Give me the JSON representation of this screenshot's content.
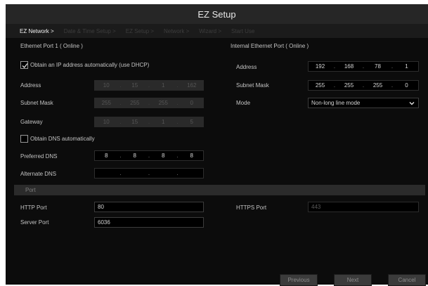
{
  "window": {
    "title": "EZ Setup"
  },
  "steps": [
    {
      "label": "EZ Network >",
      "active": true
    },
    {
      "label": "Date & Time Setup >",
      "active": false
    },
    {
      "label": "EZ Setup >",
      "active": false
    },
    {
      "label": "Network >",
      "active": false
    },
    {
      "label": "Wizard >",
      "active": false
    },
    {
      "label": "Start Use",
      "active": false
    }
  ],
  "ethernet": {
    "section_label": "Ethernet Port 1 ( Online )",
    "dhcp_checkbox": {
      "label": "Obtain an IP address automatically (use DHCP)",
      "checked": true
    },
    "address": {
      "label": "Address",
      "octets": [
        "10",
        "15",
        "1",
        "162"
      ]
    },
    "subnet_mask": {
      "label": "Subnet Mask",
      "octets": [
        "255",
        "255",
        "255",
        "0"
      ]
    },
    "gateway": {
      "label": "Gateway",
      "octets": [
        "10",
        "15",
        "1",
        "5"
      ]
    },
    "dns_checkbox": {
      "label": "Obtain DNS automatically",
      "checked": false
    },
    "preferred_dns": {
      "label": "Preferred DNS",
      "octets": [
        "8",
        "8",
        "8",
        "8"
      ]
    },
    "alternate_dns": {
      "label": "Alternate DNS",
      "octets": [
        "",
        "",
        "",
        ""
      ]
    }
  },
  "internal": {
    "section_label": "Internal Ethernet Port ( Online )",
    "address": {
      "label": "Address",
      "octets": [
        "192",
        "168",
        "78",
        "1"
      ]
    },
    "subnet_mask": {
      "label": "Subnet Mask",
      "octets": [
        "255",
        "255",
        "255",
        "0"
      ]
    },
    "mode": {
      "label": "Mode",
      "value": "Non-long line mode"
    }
  },
  "port": {
    "section_label": "Port",
    "http": {
      "label": "HTTP Port",
      "value": "80"
    },
    "https": {
      "label": "HTTPS Port",
      "value": "443"
    },
    "server": {
      "label": "Server Port",
      "value": "6036"
    }
  },
  "buttons": {
    "previous": "Previous",
    "next": "Next",
    "cancel": "Cancel"
  }
}
